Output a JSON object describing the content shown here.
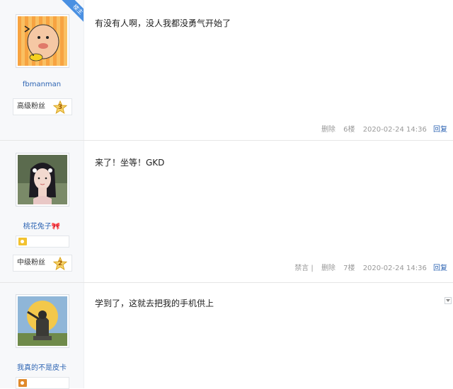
{
  "posts": [
    {
      "is_owner": true,
      "owner_label": "楼主",
      "username": "fbmanman",
      "level_name": "高级粉丝",
      "level": "3",
      "content": "有没有人啊，没人我都没勇气开始了",
      "actions": [
        "删除"
      ],
      "floor": "6楼",
      "time": "2020-02-24 14:36",
      "reply_label": "回复"
    },
    {
      "is_owner": false,
      "username": "桃花兔子",
      "level_name": "中级粉丝",
      "level": "2",
      "content": "来了！坐等！GKD",
      "actions": [
        "禁言 |",
        "删除"
      ],
      "floor": "7楼",
      "time": "2020-02-24 14:36",
      "reply_label": "回复"
    },
    {
      "is_owner": false,
      "username": "我真的不是皮卡",
      "content": "学到了，这就去把我的手机供上"
    }
  ],
  "colors": {
    "link": "#2d64b3",
    "owner_ribbon": "#4a90e2",
    "sidebar_bg": "#f7f8fa",
    "meta_text": "#999999"
  }
}
